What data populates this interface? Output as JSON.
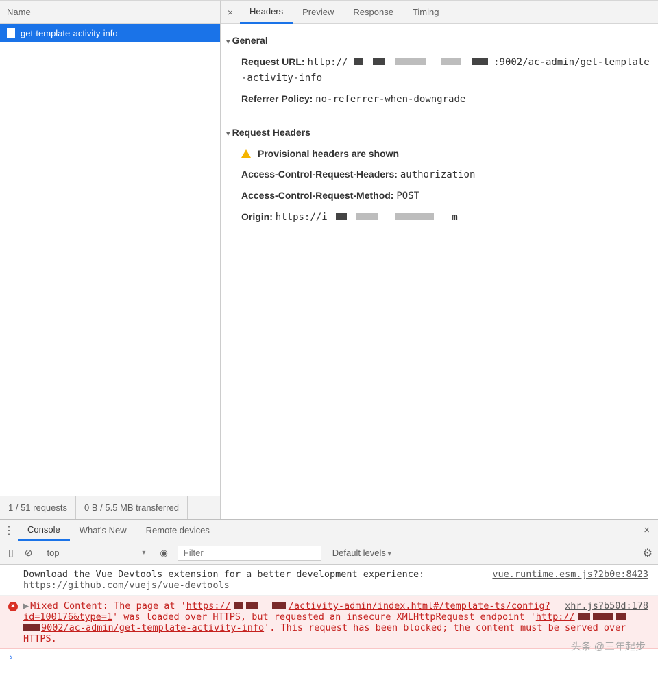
{
  "network": {
    "name_header": "Name",
    "request_item": "get-template-activity-info",
    "status_requests": "1 / 51 requests",
    "status_transferred": "0 B / 5.5 MB transferred",
    "tabs": [
      "Headers",
      "Preview",
      "Response",
      "Timing"
    ],
    "active_tab": 0,
    "general": {
      "title": "General",
      "request_url_label": "Request URL:",
      "request_url_prefix": "http://",
      "request_url_suffix": ":9002/ac-admin/get-template-activity-info",
      "referrer_label": "Referrer Policy:",
      "referrer_value": "no-referrer-when-downgrade"
    },
    "req_headers": {
      "title": "Request Headers",
      "provisional": "Provisional headers are shown",
      "acrh_label": "Access-Control-Request-Headers:",
      "acrh_value": "authorization",
      "acrm_label": "Access-Control-Request-Method:",
      "acrm_value": "POST",
      "origin_label": "Origin:",
      "origin_prefix": "https://i",
      "origin_suffix": "m"
    }
  },
  "drawer": {
    "tabs": [
      "Console",
      "What's New",
      "Remote devices"
    ],
    "active_tab": 0,
    "toolbar": {
      "context": "top",
      "filter_placeholder": "Filter",
      "levels": "Default levels"
    },
    "msg1": {
      "text_a": "Download the Vue Devtools extension for a better development experience:",
      "link": "https://github.com/vuejs/vue-devtools",
      "source": "vue.runtime.esm.js?2b0e:8423"
    },
    "err": {
      "source": "xhr.js?b50d:178",
      "pre": "Mixed Content: The page at '",
      "link1_a": "https://",
      "link1_b": "/activity-admin/index.html#/template-ts/config?id=100176&type=1",
      "mid1": "' was loaded over HTTPS, but requested an insecure XMLHttpRequest endpoint '",
      "link2_a": "http://",
      "link2_b": "9002/ac-admin/get-template-activity-info",
      "mid2": "'. This request has been blocked; the content must be served over HTTPS."
    },
    "prompt": "›"
  },
  "watermark": "头条 @三年起步"
}
